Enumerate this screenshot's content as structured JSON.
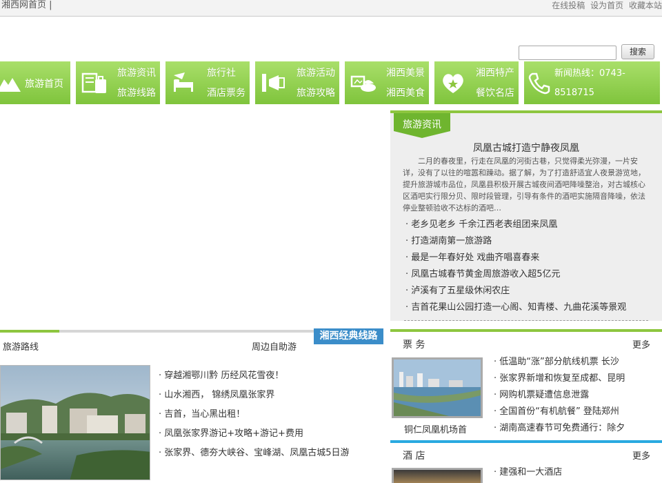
{
  "topbar": {
    "home_label": "湘西网首页 |",
    "links": [
      "在线投稿",
      "设为首页",
      "收藏本站"
    ]
  },
  "search": {
    "placeholder": "",
    "button_label": "搜索"
  },
  "nav": {
    "items": [
      {
        "label": "旅游首页",
        "icon": "mountain-icon"
      },
      {
        "line1": "旅游资讯",
        "line2": "旅游线路",
        "icon": "luggage-icon"
      },
      {
        "line1": "旅行社",
        "line2": "酒店票务",
        "icon": "hotel-bed-icon"
      },
      {
        "line1": "旅游活动",
        "line2": "旅游攻略",
        "icon": "megaphone-icon"
      },
      {
        "line1": "湘西美景",
        "line2": "湘西美食",
        "icon": "food-dish-icon"
      },
      {
        "line1": "湘西特产",
        "line2": "餐饮名店",
        "icon": "heart-star-icon"
      }
    ],
    "hotline": {
      "line1": "新闻热线：0743-",
      "line2": "8518715",
      "icon": "phone-icon"
    }
  },
  "news": {
    "tab_label": "旅游资讯",
    "headline": "凤凰古城打造宁静夜凤凰",
    "summary": "二月的春夜里，行走在凤凰的河街古巷，只觉得柔光弥漫，一片安详，没有了以往的喧嚣和躁动。据了解，为了打造舒适宜人夜景游览地，提升旅游城市品位，凤凰县积极开展古城夜间酒吧降噪整治，对古城核心区酒吧实行限分贝、限时段管理，引导有条件的酒吧实施隔音降噪，依法停业整顿验收不达标的酒吧…",
    "items": [
      "· 老乡见老乡  千余江西老表组团来凤凰",
      "· 打造湖南第一旅游路",
      "· 最是一年春好处 戏曲齐唱喜春来",
      "· 凤凰古城春节黄金周旅游收入超5亿元",
      "· 泸溪有了五星级休闲农庄",
      "· 吉首花果山公园打造一心阁、知青楼、九曲花溪等景观"
    ]
  },
  "routes": {
    "badge": "湘西经典线路",
    "title": "旅游路线",
    "more": "周边自助游",
    "items": [
      "· 穿越湘鄂川黔 历经风花雪夜！",
      "· 山水湘西， 锦绣凤凰张家界",
      "· 吉首，当心黑出租！",
      "· 凤凰张家界游记+攻略+游记+费用",
      "· 张家界、德夯大峡谷、宝峰湖、凤凰古城5日游"
    ]
  },
  "tickets": {
    "title": "票 务",
    "more": "更多",
    "photo_caption": "铜仁凤凰机场首",
    "items": [
      "· 低温助“涨”部分航线机票 长沙",
      "· 张家界新增和恢复至成都、昆明",
      "· 网购机票疑遭信息泄露",
      "· 全国首份“有机航餐” 登陆郑州",
      "· 湖南高速春节可免费通行：除夕"
    ]
  },
  "hotels": {
    "title": "酒 店",
    "more": "更多",
    "items": [
      "· 建强和一大酒店"
    ]
  },
  "colors": {
    "nav_green": "#8dc63f",
    "badge_blue": "#3b8dc9",
    "ticket_line": "#8dc63f",
    "hotel_line": "#29a9e0"
  }
}
